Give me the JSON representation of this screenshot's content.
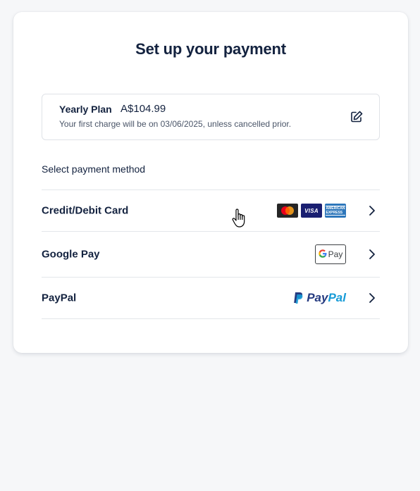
{
  "page": {
    "title": "Set up your payment"
  },
  "plan": {
    "name": "Yearly Plan",
    "price": "A$104.99",
    "note": "Your first charge will be on 03/06/2025, unless cancelled prior.",
    "edit_icon": "edit-icon"
  },
  "payment": {
    "section_label": "Select payment method",
    "methods": [
      {
        "label": "Credit/Debit Card",
        "logos": [
          "mastercard-logo",
          "visa-logo",
          "amex-logo"
        ]
      },
      {
        "label": "Google Pay",
        "logos": [
          "google-pay-logo"
        ]
      },
      {
        "label": "PayPal",
        "logos": [
          "paypal-logo"
        ]
      }
    ]
  },
  "logos": {
    "visa_text": "VISA",
    "amex_text_1": "AMERICAN",
    "amex_text_2": "EXPRESS",
    "gpay_g": "G",
    "gpay_text": "Pay",
    "paypal_pay": "Pay",
    "paypal_pal": "Pal"
  },
  "colors": {
    "text": "#13223f",
    "border": "#e3e6ea",
    "visa": "#1a1f71",
    "amex": "#2e77bb",
    "paypal_dark": "#253b80",
    "paypal_light": "#179bd7"
  }
}
